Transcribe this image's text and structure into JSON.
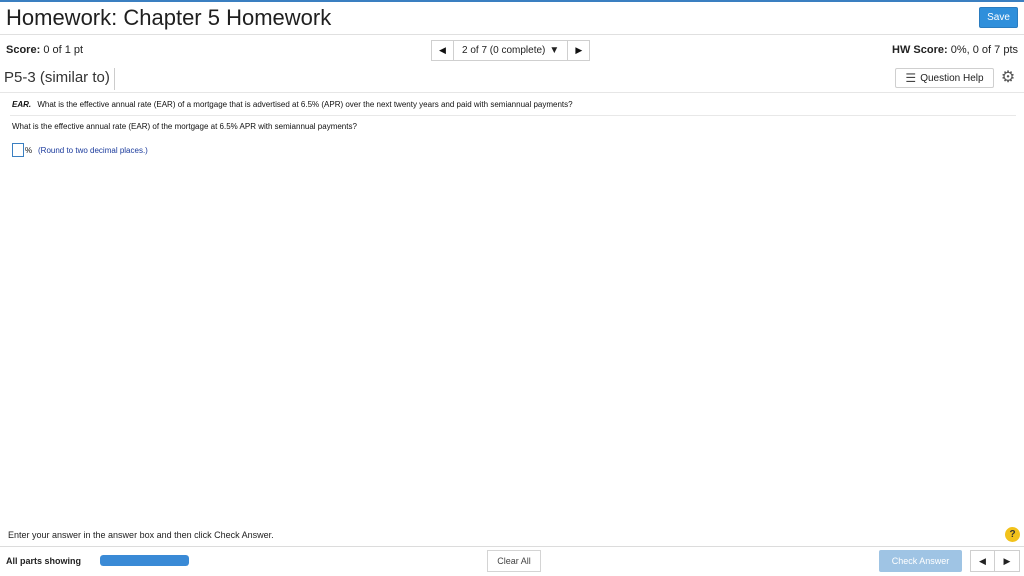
{
  "header": {
    "title": "Homework: Chapter 5 Homework",
    "save_label": "Save"
  },
  "score": {
    "label": "Score:",
    "value": "0 of 1 pt"
  },
  "nav": {
    "position": "2 of 7 (0 complete)",
    "prev_icon": "triangle-left-icon",
    "next_icon": "triangle-right-icon"
  },
  "hw_score": {
    "label": "HW Score:",
    "value": "0%, 0 of 7 pts"
  },
  "problem": {
    "title": "P5-3 (similar to)",
    "question_help": "Question Help",
    "tag": "EAR.",
    "question": "What is the effective annual rate (EAR) of a mortgage that is advertised at 6.5% (APR) over the next twenty years and paid with semiannual payments?",
    "subquestion": "What is the effective annual rate (EAR) of the mortgage at 6.5% APR with semiannual payments?",
    "answer_value": "",
    "unit": "%",
    "hint": "(Round to two decimal places.)"
  },
  "footer": {
    "instruction": "Enter your answer in the answer box and then click Check Answer.",
    "parts_label": "All parts showing",
    "progress_fraction": 1.0,
    "clear_label": "Clear All",
    "check_label": "Check Answer",
    "help_symbol": "?"
  },
  "colors": {
    "accent": "#2f8fdb",
    "progress": "#3a8ad6",
    "help": "#f2c21b",
    "hint_text": "#1a3a9c"
  }
}
